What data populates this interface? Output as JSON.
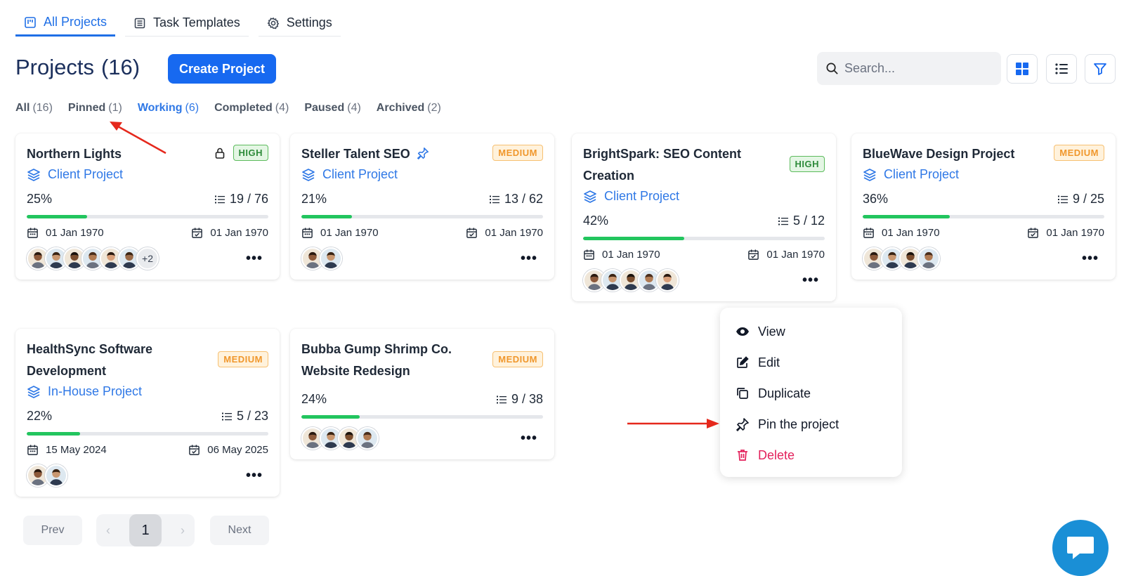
{
  "tabs": [
    {
      "label": "All Projects",
      "icon": "kanban-icon",
      "active": true
    },
    {
      "label": "Task Templates",
      "icon": "list-doc-icon",
      "active": false
    },
    {
      "label": "Settings",
      "icon": "gear-icon",
      "active": false
    }
  ],
  "header": {
    "title": "Projects",
    "count": "(16)",
    "create_label": "Create Project",
    "search_placeholder": "Search..."
  },
  "filters": [
    {
      "label": "All",
      "count": "(16)"
    },
    {
      "label": "Pinned",
      "count": "(1)"
    },
    {
      "label": "Working",
      "count": "(6)",
      "active": true
    },
    {
      "label": "Completed",
      "count": "(4)"
    },
    {
      "label": "Paused",
      "count": "(4)"
    },
    {
      "label": "Archived",
      "count": "(2)"
    }
  ],
  "projects": [
    {
      "title": "Northern Lights",
      "priority": "HIGH",
      "locked": true,
      "type": "Client Project",
      "progress": "25%",
      "progress_value": 25,
      "tasks": "19 / 76",
      "start": "01 Jan 1970",
      "end": "01 Jan 1970",
      "avatars": 6,
      "more": "+2"
    },
    {
      "title": "Steller Talent SEO",
      "priority": "MEDIUM",
      "pinned": true,
      "type": "Client Project",
      "progress": "21%",
      "progress_value": 21,
      "tasks": "13 / 62",
      "start": "01 Jan 1970",
      "end": "01 Jan 1970",
      "avatars": 2
    },
    {
      "title": "BrightSpark: SEO Content Creation",
      "priority": "HIGH",
      "type": "Client Project",
      "progress": "42%",
      "progress_value": 42,
      "tasks": "5 / 12",
      "start": "01 Jan 1970",
      "end": "01 Jan 1970",
      "avatars": 5
    },
    {
      "title": "BlueWave Design Project",
      "priority": "MEDIUM",
      "type": "Client Project",
      "progress": "36%",
      "progress_value": 36,
      "tasks": "9 / 25",
      "start": "01 Jan 1970",
      "end": "01 Jan 1970",
      "avatars": 4
    },
    {
      "title": "HealthSync Software Development",
      "priority": "MEDIUM",
      "type": "In-House Project",
      "progress": "22%",
      "progress_value": 22,
      "tasks": "5 / 23",
      "start": "15 May 2024",
      "end": "06 May 2025",
      "avatars": 2
    },
    {
      "title": "Bubba Gump Shrimp Co. Website Redesign",
      "priority": "MEDIUM",
      "progress": "24%",
      "progress_value": 24,
      "tasks": "9 / 38",
      "avatars": 4
    }
  ],
  "menu": [
    {
      "label": "View",
      "icon": "eye-icon"
    },
    {
      "label": "Edit",
      "icon": "edit-icon"
    },
    {
      "label": "Duplicate",
      "icon": "copy-icon"
    },
    {
      "label": "Pin the project",
      "icon": "pin-icon"
    },
    {
      "label": "Delete",
      "icon": "trash-icon",
      "danger": true
    }
  ],
  "pagination": {
    "prev": "Prev",
    "next": "Next",
    "page": "1",
    "left_chevron": "‹",
    "right_chevron": "›"
  },
  "colors": {
    "accent": "#1769f0",
    "progress": "#22c55e",
    "danger": "#e3225c",
    "high": "#2e8b3a",
    "medium": "#f0972c"
  }
}
